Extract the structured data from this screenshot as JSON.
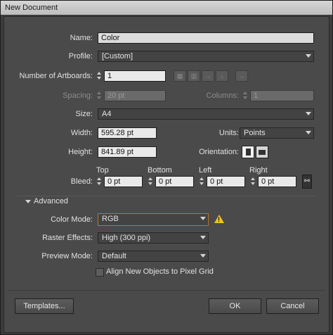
{
  "window": {
    "title": "New Document"
  },
  "name": {
    "label": "Name:",
    "value": "Color"
  },
  "profile": {
    "label": "Profile:",
    "value": "[Custom]"
  },
  "artboards": {
    "label": "Number of Artboards:",
    "value": "1"
  },
  "spacing": {
    "label": "Spacing:",
    "value": "20 pt"
  },
  "columns": {
    "label": "Columns:",
    "value": "1"
  },
  "size": {
    "label": "Size:",
    "value": "A4"
  },
  "width": {
    "label": "Width:",
    "value": "595.28 pt"
  },
  "units": {
    "label": "Units:",
    "value": "Points"
  },
  "height": {
    "label": "Height:",
    "value": "841.89 pt"
  },
  "orientation": {
    "label": "Orientation:"
  },
  "bleed": {
    "label": "Bleed:",
    "top": {
      "label": "Top",
      "value": "0 pt"
    },
    "bottom": {
      "label": "Bottom",
      "value": "0 pt"
    },
    "left": {
      "label": "Left",
      "value": "0 pt"
    },
    "right": {
      "label": "Right",
      "value": "0 pt"
    }
  },
  "advanced": {
    "label": "Advanced"
  },
  "color_mode": {
    "label": "Color Mode:",
    "value": "RGB"
  },
  "raster": {
    "label": "Raster Effects:",
    "value": "High (300 ppi)"
  },
  "preview": {
    "label": "Preview Mode:",
    "value": "Default"
  },
  "align": {
    "label": "Align New Objects to Pixel Grid"
  },
  "buttons": {
    "templates": "Templates...",
    "ok": "OK",
    "cancel": "Cancel"
  },
  "colors": {
    "accent_border": "#b8742b",
    "warning": "#f0c419"
  },
  "icons": [
    "warning-icon",
    "chevron-down-icon",
    "link-icon",
    "portrait-icon",
    "landscape-icon",
    "triangle-down-icon"
  ]
}
